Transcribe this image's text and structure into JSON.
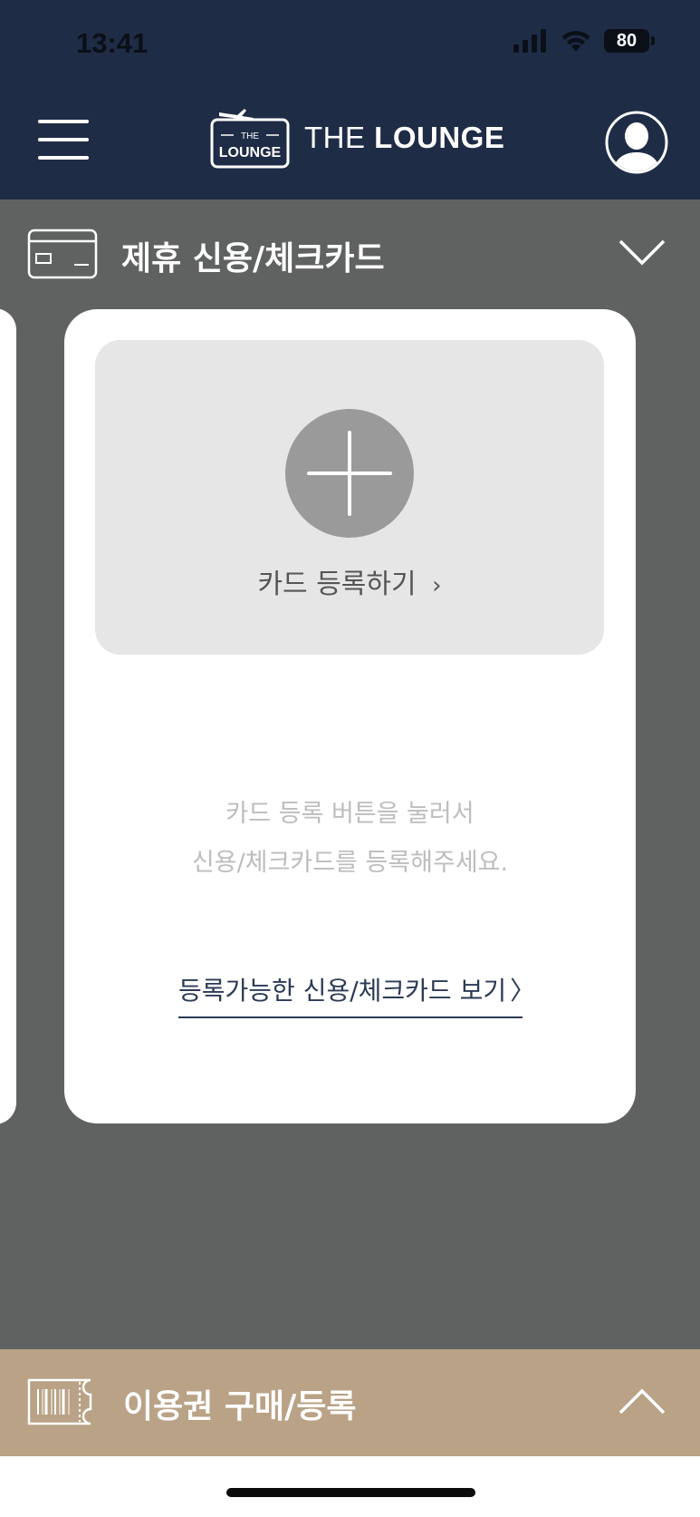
{
  "status_bar": {
    "time": "13:41",
    "battery": "80"
  },
  "header": {
    "logo_badge_top": "THE",
    "logo_badge_bottom": "LOUNGE",
    "logo_text_thin": "THE",
    "logo_text_bold": "LOUNGE",
    "menu_icon": "hamburger-icon",
    "profile_icon": "user-avatar-icon"
  },
  "section": {
    "title": "제휴 신용/체크카드",
    "icon": "credit-card-icon",
    "toggle_icon": "chevron-down-icon"
  },
  "card": {
    "register_label": "카드 등록하기",
    "register_arrow": "›",
    "guide_line1": "카드 등록 버튼을 눌러서",
    "guide_line2": "신용/체크카드를 등록해주세요.",
    "view_link": "등록가능한 신용/체크카드 보기",
    "view_link_arrow": "〉"
  },
  "ticket_bar": {
    "title": "이용권 구매/등록",
    "icon": "ticket-barcode-icon",
    "toggle_icon": "chevron-up-icon"
  },
  "colors": {
    "header_bg": "#1f2c46",
    "main_bg": "#606262",
    "ticket_bar_bg": "#b9a286",
    "card_bg": "#ffffff",
    "register_area_bg": "#e6e6e6"
  }
}
